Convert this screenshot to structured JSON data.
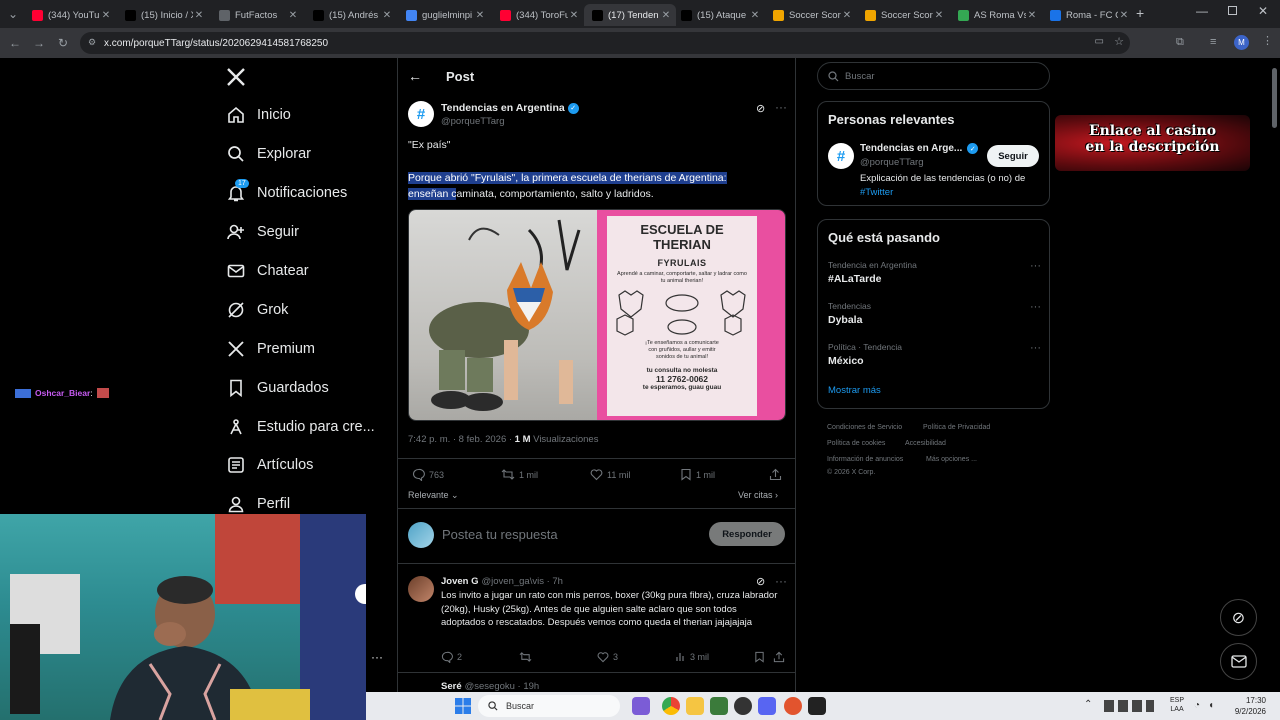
{
  "browser": {
    "tabs": [
      {
        "label": "(344) YouTu",
        "icon": "youtube-icon",
        "color": "#ff0033"
      },
      {
        "label": "(15) Inicio / X",
        "icon": "x-icon",
        "color": "#000000"
      },
      {
        "label": "FutFactos",
        "icon": "bookmark-icon",
        "color": "#5f6368"
      },
      {
        "label": "(15) Andrés",
        "icon": "x-icon",
        "color": "#000000"
      },
      {
        "label": "guglielminpi",
        "icon": "google-icon",
        "color": "#4285f4"
      },
      {
        "label": "(344) ToroFu",
        "icon": "youtube-icon",
        "color": "#ff0033"
      },
      {
        "label": "(17) Tenden",
        "icon": "x-icon",
        "color": "#000000"
      },
      {
        "label": "(15) Ataque",
        "icon": "x-icon",
        "color": "#000000"
      },
      {
        "label": "Soccer Scor",
        "icon": "ublock-icon",
        "color": "#f0a500"
      },
      {
        "label": "Soccer Scor",
        "icon": "ublock-icon",
        "color": "#f0a500"
      },
      {
        "label": "AS Roma Vs",
        "icon": "leaf-icon",
        "color": "#34a853"
      },
      {
        "label": "Roma - FC C",
        "icon": "fc-icon",
        "color": "#1a73e8"
      }
    ],
    "url": "x.com/porqueTTarg/status/2020629414581768250"
  },
  "sidebar": {
    "items": [
      {
        "label": "Inicio",
        "icon": "home-icon"
      },
      {
        "label": "Explorar",
        "icon": "search-icon"
      },
      {
        "label": "Notificaciones",
        "icon": "bell-icon",
        "badge": "17"
      },
      {
        "label": "Seguir",
        "icon": "follow-icon"
      },
      {
        "label": "Chatear",
        "icon": "mail-icon"
      },
      {
        "label": "Grok",
        "icon": "grok-icon"
      },
      {
        "label": "Premium",
        "icon": "x-icon"
      },
      {
        "label": "Guardados",
        "icon": "bookmark-icon"
      },
      {
        "label": "Estudio para cre...",
        "icon": "studio-icon"
      },
      {
        "label": "Artículos",
        "icon": "article-icon"
      },
      {
        "label": "Perfil",
        "icon": "profile-icon"
      }
    ]
  },
  "header": {
    "title": "Post"
  },
  "post": {
    "author_name": "Tendencias en Argentina",
    "author_handle": "@porqueTTarg",
    "line1": "\"Ex país\"",
    "text_highlight_a": "Porque abrió \"Fyrulais\", la primera escuela de therians de Argentina:",
    "text_highlight_b": "enseñan c",
    "text_rest": "aminata, comportamiento, salto y ladridos.",
    "poster": {
      "title_1": "ESCUELA DE",
      "title_2": "THERIAN",
      "brand": "FYRULAIS",
      "desc": "Aprendé a caminar, comportarte, saltar y ladrar como tu animal therian!",
      "desc2": "¡Te enseñamos a comunicarte con gruñidos, aullar y emitir sonidos de tu animal!",
      "consult": "tu consulta no molesta",
      "phone": "11 2762-0062",
      "footer": "te esperamos, guau guau"
    },
    "time": "7:42 p. m. · 8 feb. 2026 · ",
    "views_count": "1 M",
    "views_label": " Visualizaciones",
    "replies": "763",
    "reposts": "1 mil",
    "likes": "11 mil",
    "bookmarks": "1 mil",
    "sort_label": "Relevante",
    "quotes_label": "Ver citas"
  },
  "reply_box": {
    "placeholder": "Postea tu respuesta",
    "button": "Responder"
  },
  "reply": {
    "name": "Joven G",
    "handle": "@joven_ga\\vis · 7h",
    "text": "Los invito a jugar un rato con mis perros, boxer (30kg pura fibra), cruza labrador (20kg), Husky (25kg). Antes de que alguien salte aclaro que son todos adoptados o rescatados. Después vemos como queda el therian jajajajaja",
    "replies": "2",
    "likes": "3",
    "views": "3 mil"
  },
  "reply2": {
    "name": "Seré",
    "handle": "@sesegoku · 19h"
  },
  "right": {
    "search_placeholder": "Buscar",
    "relevant_title": "Personas relevantes",
    "rel_name": "Tendencias en Arge...",
    "rel_handle": "@porqueTTarg",
    "rel_bio": "Explicación de las tendencias (o no) de",
    "rel_link": "#Twitter",
    "follow_button": "Seguir",
    "trends_title": "Qué está pasando",
    "trends": [
      {
        "context": "Tendencia en Argentina",
        "name": "#ALaTarde"
      },
      {
        "context": "Tendencias",
        "name": "Dybala"
      },
      {
        "context": "Política · Tendencia",
        "name": "México"
      }
    ],
    "show_more": "Mostrar más",
    "footer_links": [
      "Condiciones de Servicio",
      "Política de Privacidad",
      "Política de cookies",
      "Accesibilidad",
      "Información de anuncios",
      "Más opciones ...",
      "© 2026 X Corp."
    ]
  },
  "overlay": {
    "casino_line1": "Enlace al casino",
    "casino_line2": "en la descripción",
    "chat_user": "Oshcar_Biear",
    "chat_suffix": " :"
  },
  "taskbar": {
    "search": "Buscar",
    "lang1": "ESP",
    "lang2": "LAA",
    "time": "17:30",
    "date": "9/2/2026"
  },
  "colors": {
    "accent": "#1d9bf0",
    "selection": "#1f3f8f",
    "verified": "#1d9bf0"
  }
}
